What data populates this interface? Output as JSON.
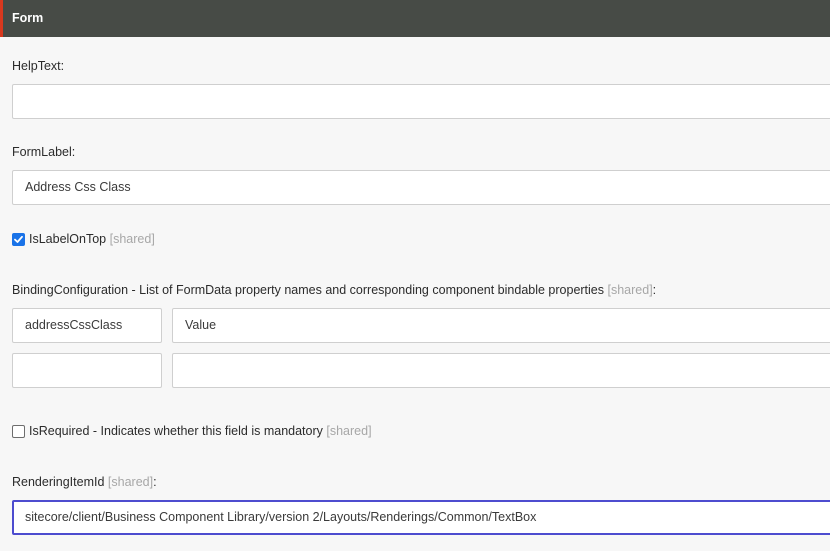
{
  "header": {
    "title": "Form"
  },
  "help_text": {
    "label": "HelpText:",
    "value": ""
  },
  "form_label": {
    "label": "FormLabel:",
    "value": "Address Css Class"
  },
  "is_label_on_top": {
    "label": "IsLabelOnTop",
    "shared": "[shared]",
    "checked": true
  },
  "binding_configuration": {
    "label": "BindingConfiguration - List of FormData property names and corresponding component bindable properties",
    "shared": "[shared]",
    "colon": ":",
    "rows": [
      {
        "key": "addressCssClass",
        "value": "Value"
      },
      {
        "key": "",
        "value": ""
      }
    ]
  },
  "is_required": {
    "label": "IsRequired - Indicates whether this field is mandatory",
    "shared": "[shared]",
    "checked": false
  },
  "rendering_item_id": {
    "label": "RenderingItemId",
    "shared": "[shared]",
    "colon": ":",
    "value": "sitecore/client/Business Component Library/version 2/Layouts/Renderings/Common/TextBox"
  },
  "colors": {
    "header_bg": "#474b46",
    "header_accent": "#d9381e",
    "focus_border": "#4d4ccf",
    "checkbox_blue": "#1a73e8",
    "shared_gray": "#a7a7a7"
  }
}
